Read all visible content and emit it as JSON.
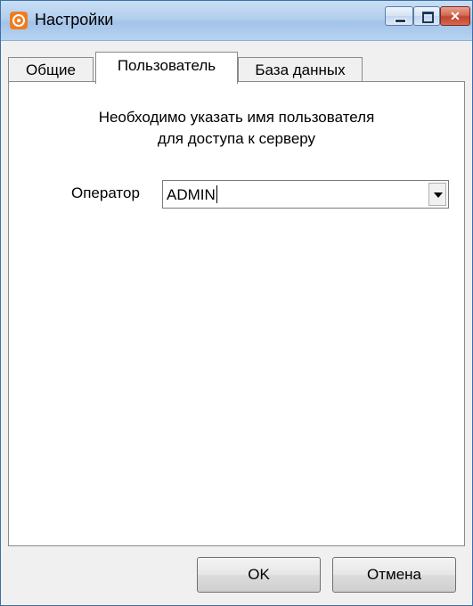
{
  "window": {
    "title": "Настройки",
    "icon": "app-logo-icon",
    "controls": {
      "minimize": "minimize-icon",
      "maximize": "maximize-icon",
      "close": "close-icon",
      "close_glyph": "✕"
    }
  },
  "tabs": [
    {
      "label": "Общие",
      "active": false
    },
    {
      "label": "Пользователь",
      "active": true
    },
    {
      "label": "База данных",
      "active": false
    }
  ],
  "panel": {
    "hint_line1": "Необходимо указать имя пользователя",
    "hint_line2": "для доступа к серверу",
    "operator_label": "Оператор",
    "operator_value": "ADMIN"
  },
  "buttons": {
    "ok": "OK",
    "cancel": "Отмена"
  },
  "colors": {
    "accent_icon": "#f07c1e",
    "close_button": "#c04430"
  }
}
